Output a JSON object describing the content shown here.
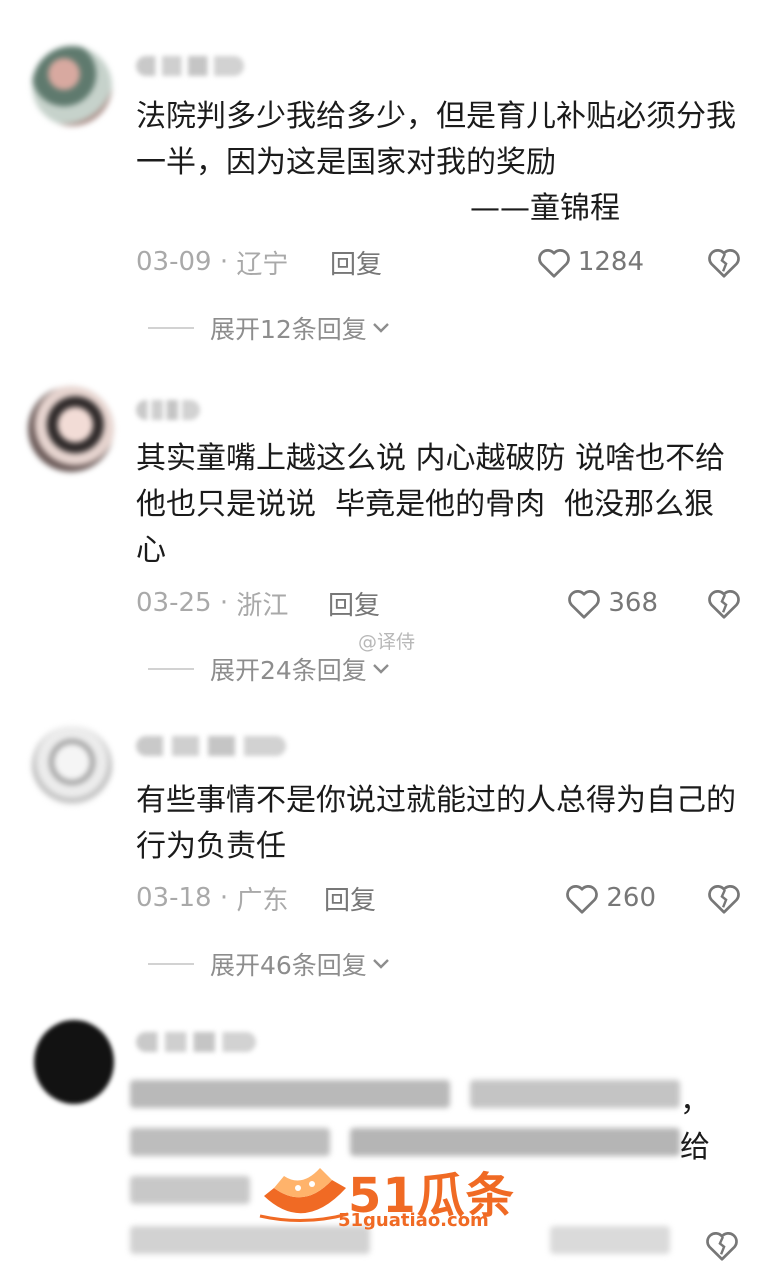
{
  "comments": [
    {
      "text": "法院判多少我给多少，但是育儿补贴必须分我一半，因为这是国家对我的奖励",
      "signature": "——童锦程",
      "date": "03-09",
      "location": "辽宁",
      "reply_label": "回复",
      "likes": "1284",
      "expand_label": "展开12条回复"
    },
    {
      "text": "其实童嘴上越这么说 内心越破防 说啥也不给他也只是说说  毕竟是他的骨肉  他没那么狠心",
      "date": "03-25",
      "location": "浙江",
      "reply_label": "回复",
      "likes": "368",
      "expand_label": "展开24条回复"
    },
    {
      "text": "有些事情不是你说过就能过的人总得为自己的行为负责任",
      "date": "03-18",
      "location": "广东",
      "reply_label": "回复",
      "likes": "260",
      "expand_label": "展开46条回复"
    }
  ],
  "watermark": "@译侍",
  "fourth_comment_visible": {
    "line1_end": "，",
    "line2_end": "给"
  },
  "site_logo": {
    "brand": "51瓜条",
    "domain": "51guatiao.com"
  },
  "icons": {
    "like": "heart-outline-icon",
    "dislike": "broken-heart-icon",
    "expand": "chevron-down-icon"
  },
  "colors": {
    "meta_text": "#a9a9a9",
    "logo_orange": "#f06a24"
  }
}
